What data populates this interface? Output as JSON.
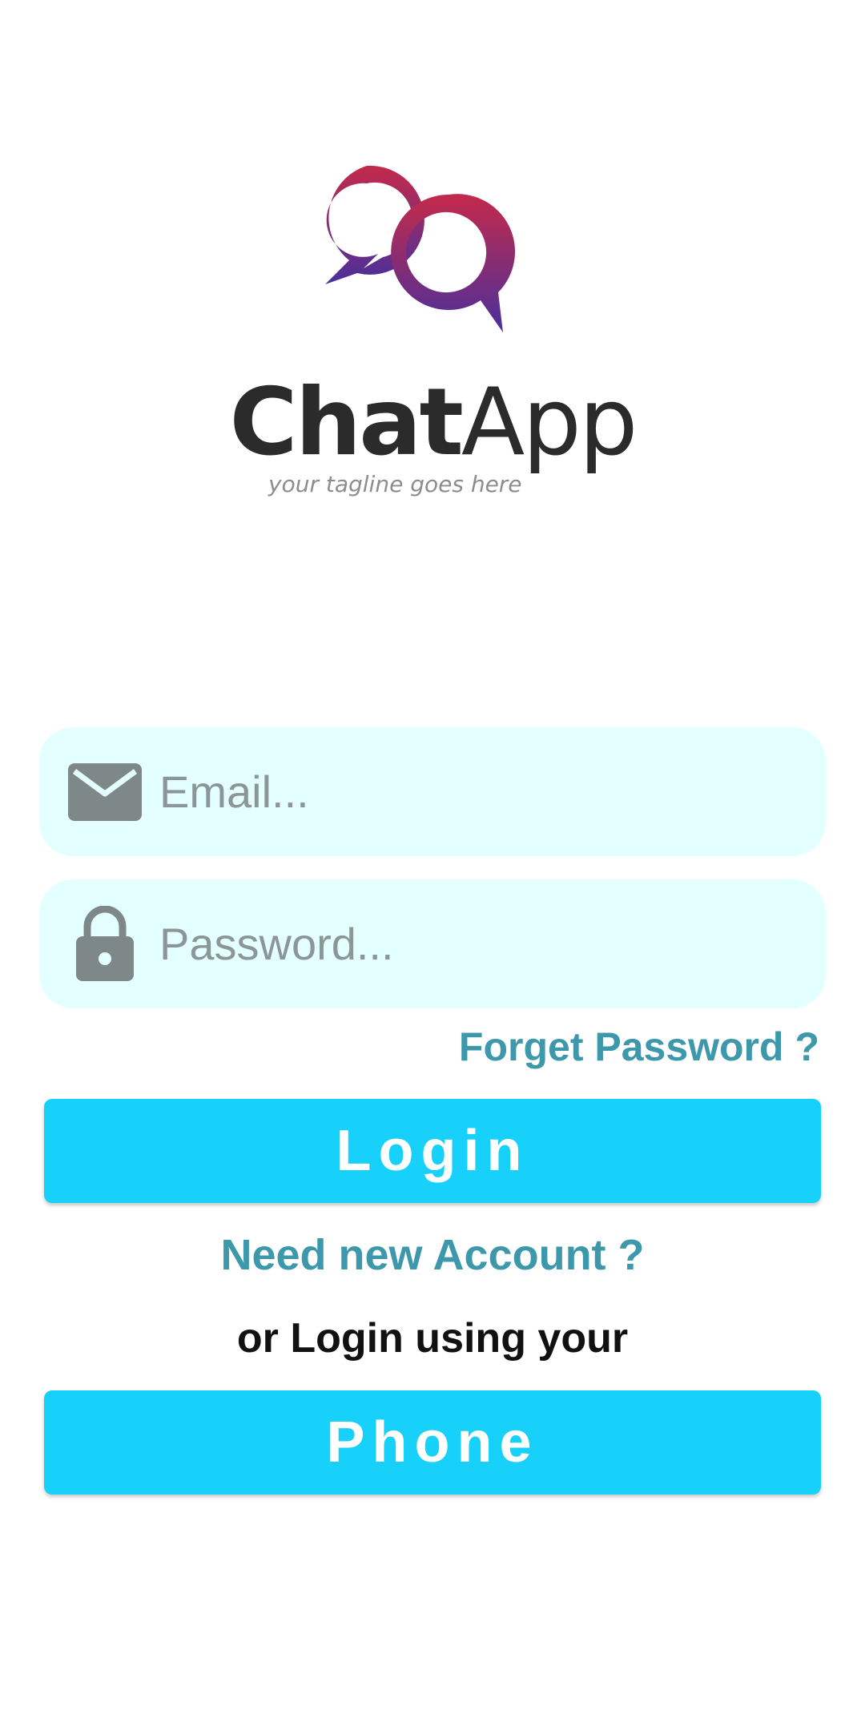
{
  "logo": {
    "name_bold": "Chat",
    "name_light": "App",
    "tagline": "your tagline goes here",
    "gradient_colors": [
      "#c42a4a",
      "#4a2f9c"
    ]
  },
  "form": {
    "email_placeholder": "Email...",
    "email_value": "",
    "email_icon": "mail-icon",
    "password_placeholder": "Password...",
    "password_value": "",
    "password_icon": "lock-icon",
    "forget_password_label": "Forget Password ?"
  },
  "actions": {
    "login_label": "Login",
    "new_account_label": "Need new Account ?",
    "alt_login_text": "or Login using your",
    "phone_label": "Phone"
  },
  "colors": {
    "field_bg": "#e4ffff",
    "button_bg": "#17d1fb",
    "link": "#3d98ab",
    "icon": "#7f8888"
  }
}
